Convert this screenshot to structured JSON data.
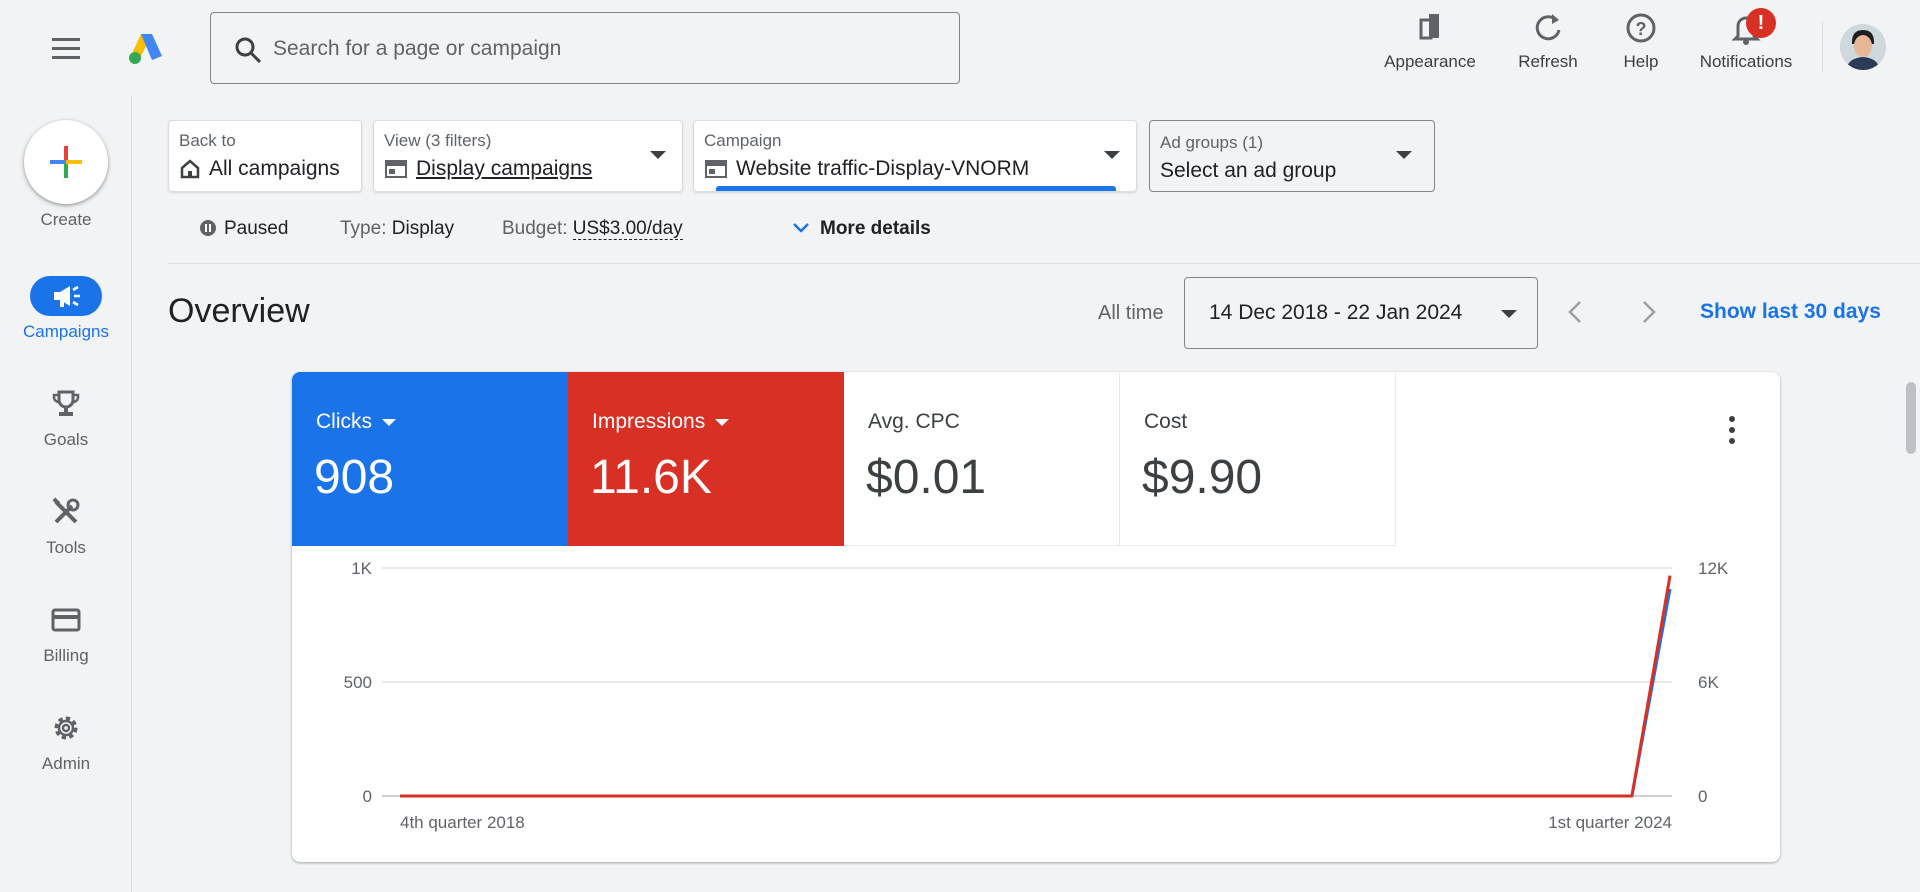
{
  "header": {
    "search_placeholder": "Search for a page or campaign",
    "tools": [
      {
        "label": "Appearance",
        "icon": "appearance-icon"
      },
      {
        "label": "Refresh",
        "icon": "refresh-icon"
      },
      {
        "label": "Help",
        "icon": "help-icon"
      },
      {
        "label": "Notifications",
        "icon": "bell-icon",
        "badge": "!"
      }
    ]
  },
  "nav": {
    "create_label": "Create",
    "items": [
      {
        "label": "Campaigns",
        "icon": "megaphone-icon",
        "active": true
      },
      {
        "label": "Goals",
        "icon": "trophy-icon"
      },
      {
        "label": "Tools",
        "icon": "tools-icon"
      },
      {
        "label": "Billing",
        "icon": "card-icon"
      },
      {
        "label": "Admin",
        "icon": "gear-icon"
      }
    ]
  },
  "filters": {
    "back": {
      "small": "Back to",
      "main": "All campaigns"
    },
    "view": {
      "small": "View (3 filters)",
      "main": "Display campaigns"
    },
    "campaign": {
      "small": "Campaign",
      "main": "Website traffic-Display-VNORM"
    },
    "adgroups": {
      "small": "Ad groups (1)",
      "main": "Select an ad group"
    }
  },
  "status": {
    "state": "Paused",
    "type_label": "Type:",
    "type_value": "Display",
    "budget_label": "Budget:",
    "budget_value": "US$3.00/day",
    "more_details": "More details"
  },
  "overview": {
    "title": "Overview",
    "range_label": "All time",
    "date_range": "14 Dec 2018 - 22 Jan 2024",
    "show_last": "Show last 30 days"
  },
  "metrics": [
    {
      "label": "Clicks",
      "value": "908",
      "color": "#1a73e8"
    },
    {
      "label": "Impressions",
      "value": "11.6K",
      "color": "#d93025"
    },
    {
      "label": "Avg. CPC",
      "value": "$0.01"
    },
    {
      "label": "Cost",
      "value": "$9.90"
    }
  ],
  "chart_data": {
    "type": "line",
    "x": [
      "4th quarter 2018",
      "1st quarter 2024"
    ],
    "y_left_ticks": [
      "0",
      "500",
      "1K"
    ],
    "y_right_ticks": [
      "0",
      "6K",
      "12K"
    ],
    "y_left_lim": [
      0,
      1000
    ],
    "y_right_lim": [
      0,
      12000
    ],
    "x_positions": [
      0,
      0.97,
      1
    ],
    "series": [
      {
        "name": "Clicks",
        "axis": "left",
        "color": "#1a73e8",
        "values": [
          0,
          0,
          908
        ]
      },
      {
        "name": "Impressions",
        "axis": "right",
        "color": "#d93025",
        "values": [
          0,
          0,
          11600
        ]
      }
    ],
    "grid": true
  }
}
